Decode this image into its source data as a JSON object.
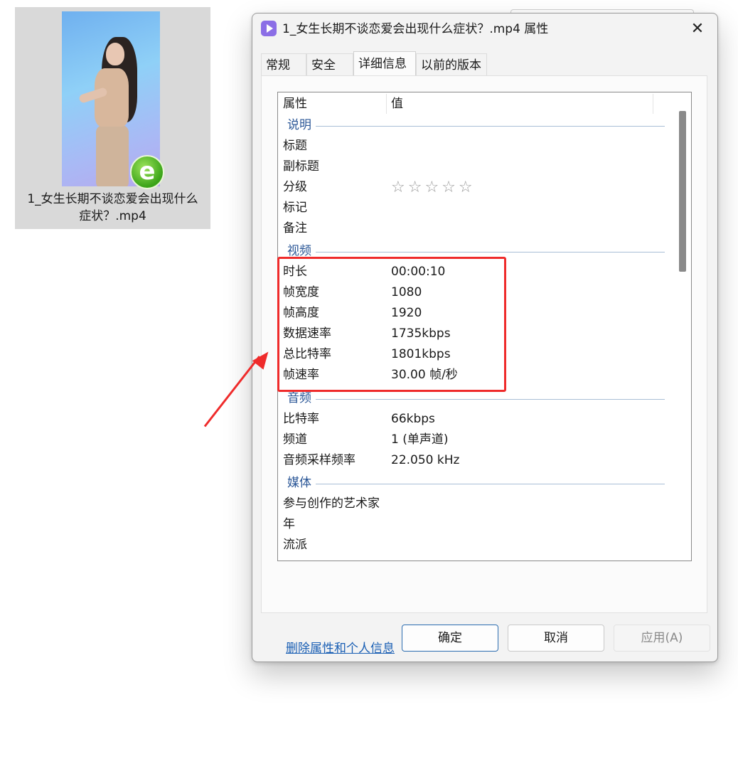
{
  "file": {
    "name_line1": "1_女生长期不谈恋爱会出现什么",
    "name_line2": "症状？.mp4"
  },
  "dialog": {
    "title": "1_女生长期不谈恋爱会出现什么症状？.mp4 属性",
    "close_label": "✕",
    "tabs": [
      {
        "label": "常规",
        "active": false
      },
      {
        "label": "安全",
        "active": false
      },
      {
        "label": "详细信息",
        "active": true
      },
      {
        "label": "以前的版本",
        "active": false
      }
    ],
    "columns": {
      "property": "属性",
      "value": "值"
    },
    "groups": {
      "description": "说明",
      "video": "视频",
      "audio": "音频",
      "media": "媒体"
    },
    "rows": {
      "title": {
        "p": "标题",
        "v": ""
      },
      "subtitle": {
        "p": "副标题",
        "v": ""
      },
      "rating": {
        "p": "分级",
        "v": "☆☆☆☆☆"
      },
      "tags": {
        "p": "标记",
        "v": ""
      },
      "comments": {
        "p": "备注",
        "v": ""
      },
      "duration": {
        "p": "时长",
        "v": "00:00:10"
      },
      "frame_width": {
        "p": "帧宽度",
        "v": "1080"
      },
      "frame_height": {
        "p": "帧高度",
        "v": "1920"
      },
      "data_rate": {
        "p": "数据速率",
        "v": "1735kbps"
      },
      "total_bitrate": {
        "p": "总比特率",
        "v": "1801kbps"
      },
      "frame_rate": {
        "p": "帧速率",
        "v": "30.00 帧/秒"
      },
      "bitrate": {
        "p": "比特率",
        "v": "66kbps"
      },
      "channels": {
        "p": "频道",
        "v": "1 (单声道)"
      },
      "sample_rate": {
        "p": "音频采样频率",
        "v": "22.050 kHz"
      },
      "artists": {
        "p": "参与创作的艺术家",
        "v": ""
      },
      "year": {
        "p": "年",
        "v": ""
      },
      "genre": {
        "p": "流派",
        "v": ""
      }
    },
    "remove_link": "删除属性和个人信息",
    "buttons": {
      "ok": "确定",
      "cancel": "取消",
      "apply": "应用(A)"
    }
  },
  "colors": {
    "accent": "#2b6cb0",
    "group_text": "#2b5797",
    "annotation": "#ef2b2b",
    "link": "#1a5fb4"
  },
  "icons": [
    "video-app-icon",
    "close-icon",
    "ie-badge-icon",
    "star-icon"
  ]
}
